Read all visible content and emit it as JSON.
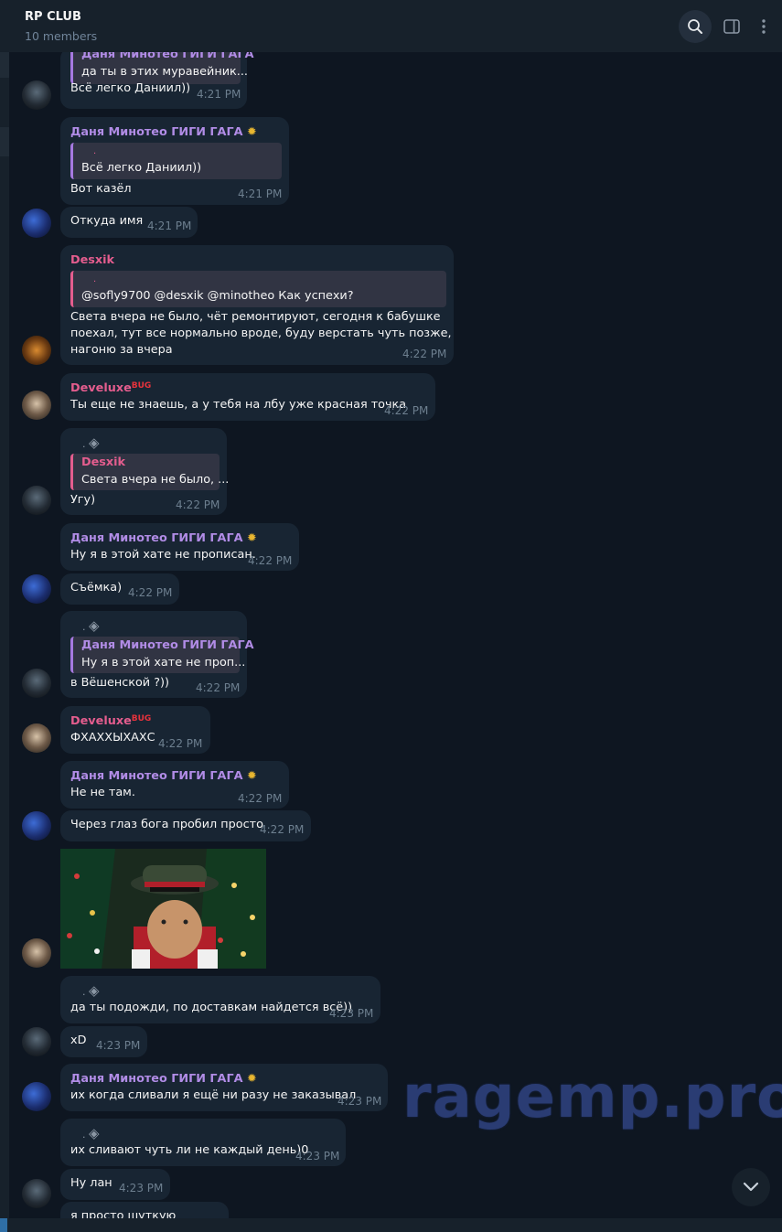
{
  "header": {
    "title": "RP CLUB",
    "subtitle": "10 members"
  },
  "icons": {
    "search": "search-icon",
    "side_panel": "side-panel-icon",
    "more": "more-vertical-icon",
    "scroll_down": "chevron-down-icon",
    "sticker": "diamond-sticker-icon"
  },
  "colors": {
    "background": "#0e1621",
    "bubble": "#182533",
    "header": "#17212b",
    "name_purple": "#b18ce6",
    "name_pink": "#e45d8e",
    "time": "#6d7f8f"
  },
  "messages": [
    {
      "quote_name": "Даня Минотео ГИГИ ГАГА",
      "quote_text": "да ты в этих муравейник...",
      "text": "Всё легко Даниил))",
      "time": "4:21 PM"
    },
    {
      "sender": "Даня Минотео ГИГИ ГАГА",
      "quote_text": "Всё легко Даниил))",
      "text": "Вот казёл",
      "time": "4:21 PM"
    },
    {
      "text": "Откуда имя",
      "time": "4:21 PM"
    },
    {
      "sender": "Desxik",
      "quote_text": "@sofly9700 @desxik @minotheo Как успехи?",
      "text_lines": [
        "Света вчера не было, чёт ремонтируют, сегодня к бабушке",
        "поехал, тут все нормально вроде, буду верстать чуть позже,",
        "нагоню за вчера"
      ],
      "time": "4:22 PM"
    },
    {
      "sender": "Develuxe",
      "sender_badge": "BUG",
      "text": "Ты еще не знаешь, а у тебя на лбу уже красная точка",
      "time": "4:22 PM"
    },
    {
      "sender_mark": ".",
      "quote_name": "Desxik",
      "quote_text": "Света вчера не было, ...",
      "text": "Угу)",
      "time": "4:22 PM"
    },
    {
      "sender": "Даня Минотео ГИГИ ГАГА",
      "text": "Ну я в этой хате не прописан.",
      "time": "4:22 PM"
    },
    {
      "text": "Съёмка)",
      "time": "4:22 PM"
    },
    {
      "sender_mark": ".",
      "quote_name": "Даня Минотео ГИГИ ГАГА",
      "quote_text": "Ну я в этой хате не проп...",
      "text": "в Вёшенской ?))",
      "time": "4:22 PM"
    },
    {
      "sender": "Develuxe",
      "sender_badge": "BUG",
      "text": "ФХАХХЫХАХС",
      "time": "4:22 PM"
    },
    {
      "sender": "Даня Минотео ГИГИ ГАГА",
      "text": "Не не там.",
      "time": "4:22 PM"
    },
    {
      "text": "Через глаз бога пробил просто",
      "time": "4:22 PM"
    },
    {
      "sender_mark": ".",
      "text": "да ты подожди, по доставкам найдется всё))",
      "time": "4:23 PM"
    },
    {
      "text": "xD",
      "time": "4:23 PM"
    },
    {
      "sender": "Даня Минотео ГИГИ ГАГА",
      "text": "их когда сливали я ещё ни разу не заказывал",
      "time": "4:23 PM"
    },
    {
      "sender_mark": ".",
      "text": "их сливают чуть ли не каждый день)0",
      "time": "4:23 PM"
    },
    {
      "text": "Ну лан",
      "time": "4:23 PM"
    },
    {
      "text": "я просто шуткую"
    }
  ],
  "watermark": "ragemp.pro"
}
